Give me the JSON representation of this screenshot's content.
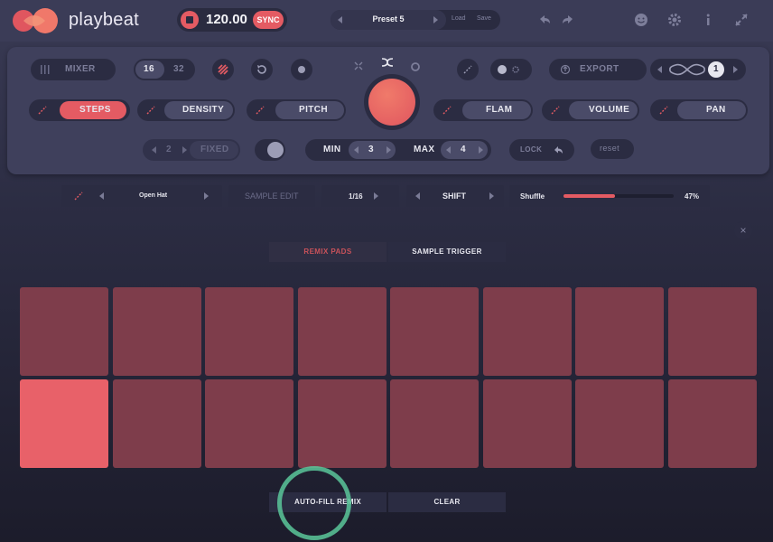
{
  "app": {
    "name": "playbeat"
  },
  "transport": {
    "bpm": "120.00",
    "sync_label": "SYNC"
  },
  "preset": {
    "name": "Preset 5",
    "load_label": "Load",
    "save_label": "Save"
  },
  "controls": {
    "mixer_label": "MIXER",
    "steps_16": "16",
    "steps_32": "32",
    "export_label": "EXPORT",
    "loop_count": "1",
    "steps_label": "STEPS",
    "density_label": "DENSITY",
    "pitch_label": "PITCH",
    "flam_label": "FLAM",
    "volume_label": "VOLUME",
    "pan_label": "PAN",
    "fixed_value": "2",
    "fixed_label": "FIXED",
    "min_label": "MIN",
    "min_value": "3",
    "max_label": "MAX",
    "max_value": "4",
    "lock_label": "LOCK",
    "reset_label": "reset"
  },
  "sample_strip": {
    "instrument": "Open Hat",
    "sample_edit_label": "SAMPLE EDIT",
    "division": "1/16",
    "shift_label": "SHIFT",
    "shuffle_label": "Shuffle",
    "shuffle_value": "47%",
    "shuffle_fraction": 0.47
  },
  "tabs": [
    {
      "label": "REMIX PADS",
      "active": true
    },
    {
      "label": "SAMPLE TRIGGER",
      "active": false
    }
  ],
  "pads": {
    "rows": 2,
    "cols": 8,
    "active_index": 8
  },
  "bottom": {
    "autofill_label": "AUTO-FILL REMIX",
    "clear_label": "CLEAR"
  },
  "colors": {
    "accent": "#e45b63",
    "pad": "#7e3d4b",
    "pad_active": "#e86169",
    "highlight_ring": "#5ac79a"
  },
  "icons": [
    "logo-icon",
    "stop-icon",
    "undo-icon",
    "redo-icon",
    "smiley-icon",
    "gear-icon",
    "info-icon",
    "expand-icon",
    "mixer-icon",
    "randomize-icon",
    "refresh-icon",
    "record-icon",
    "shuffle-icon",
    "link-icon",
    "export-icon",
    "infinity-icon",
    "lock-icon",
    "close-icon"
  ]
}
